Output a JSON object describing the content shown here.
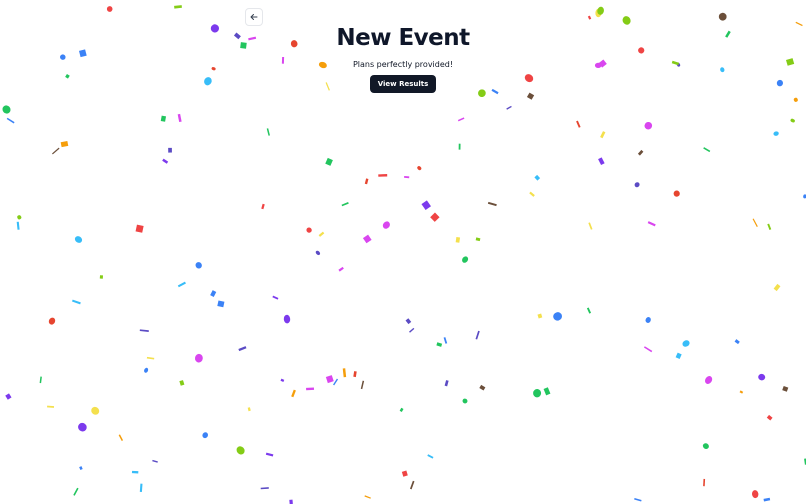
{
  "header": {
    "title": "New Event",
    "subtitle": "Plans perfectly provided!",
    "view_results_label": "View Results"
  },
  "confetti": {
    "colors": [
      "#f4e04d",
      "#e6452f",
      "#7c3aed",
      "#3b82f6",
      "#22c55e",
      "#f59e0b",
      "#5b4bc4",
      "#38bdf8",
      "#6b4f3a",
      "#d946ef",
      "#ef4444",
      "#84cc16"
    ]
  }
}
